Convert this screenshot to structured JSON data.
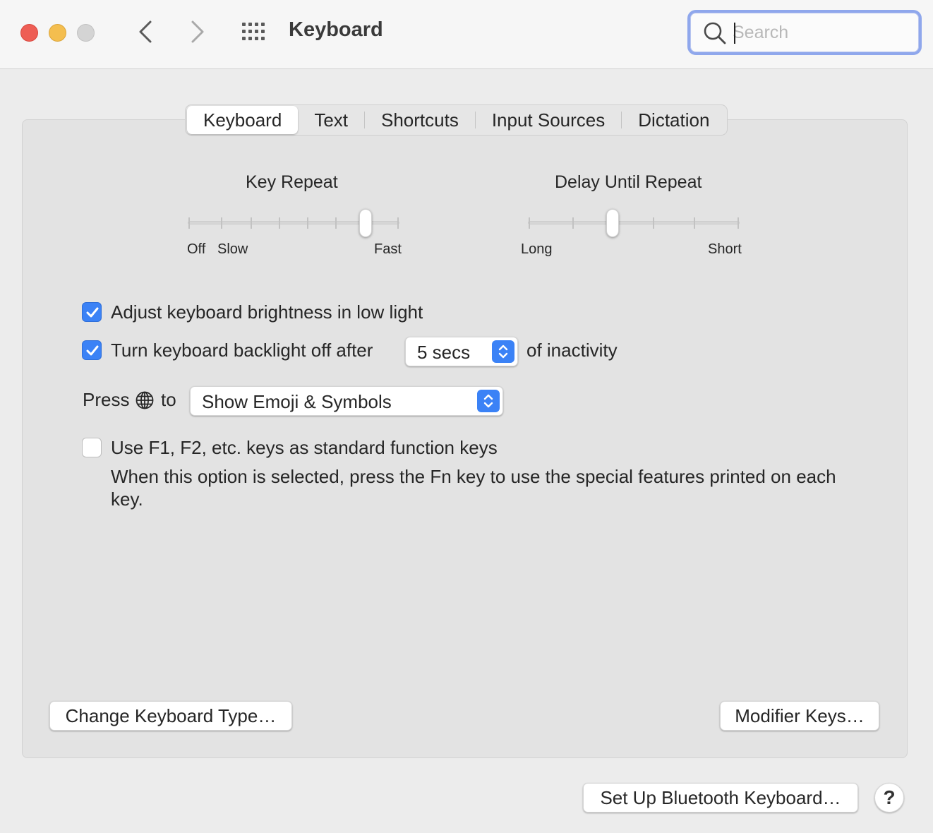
{
  "window": {
    "title": "Keyboard",
    "search_placeholder": "Search"
  },
  "tabs": [
    {
      "label": "Keyboard",
      "active": true
    },
    {
      "label": "Text",
      "active": false
    },
    {
      "label": "Shortcuts",
      "active": false
    },
    {
      "label": "Input Sources",
      "active": false
    },
    {
      "label": "Dictation",
      "active": false
    }
  ],
  "key_repeat": {
    "title": "Key Repeat",
    "labels": {
      "off": "Off",
      "slow": "Slow",
      "fast": "Fast"
    },
    "value_fraction": 0.84
  },
  "delay_until_repeat": {
    "title": "Delay Until Repeat",
    "labels": {
      "long": "Long",
      "short": "Short"
    },
    "value_fraction": 0.4
  },
  "options": {
    "brightness": {
      "label": "Adjust keyboard brightness in low light",
      "checked": true
    },
    "backlight": {
      "label": "Turn keyboard backlight off after",
      "checked": true,
      "value": "5 secs",
      "suffix": "of inactivity"
    },
    "press_globe": {
      "prefix": "Press",
      "suffix": "to",
      "value": "Show Emoji & Symbols"
    },
    "fn_keys": {
      "label": "Use F1, F2, etc. keys as standard function keys",
      "checked": false,
      "description": "When this option is selected, press the Fn key to use the special features printed on each key."
    }
  },
  "buttons": {
    "change_type": "Change Keyboard Type…",
    "modifier_keys": "Modifier Keys…",
    "bluetooth": "Set Up Bluetooth Keyboard…",
    "help": "?"
  },
  "colors": {
    "accent": "#3b82f6",
    "close": "#ee5e55",
    "minimize": "#f4be4f",
    "zoom_disabled": "#d4d4d4"
  }
}
